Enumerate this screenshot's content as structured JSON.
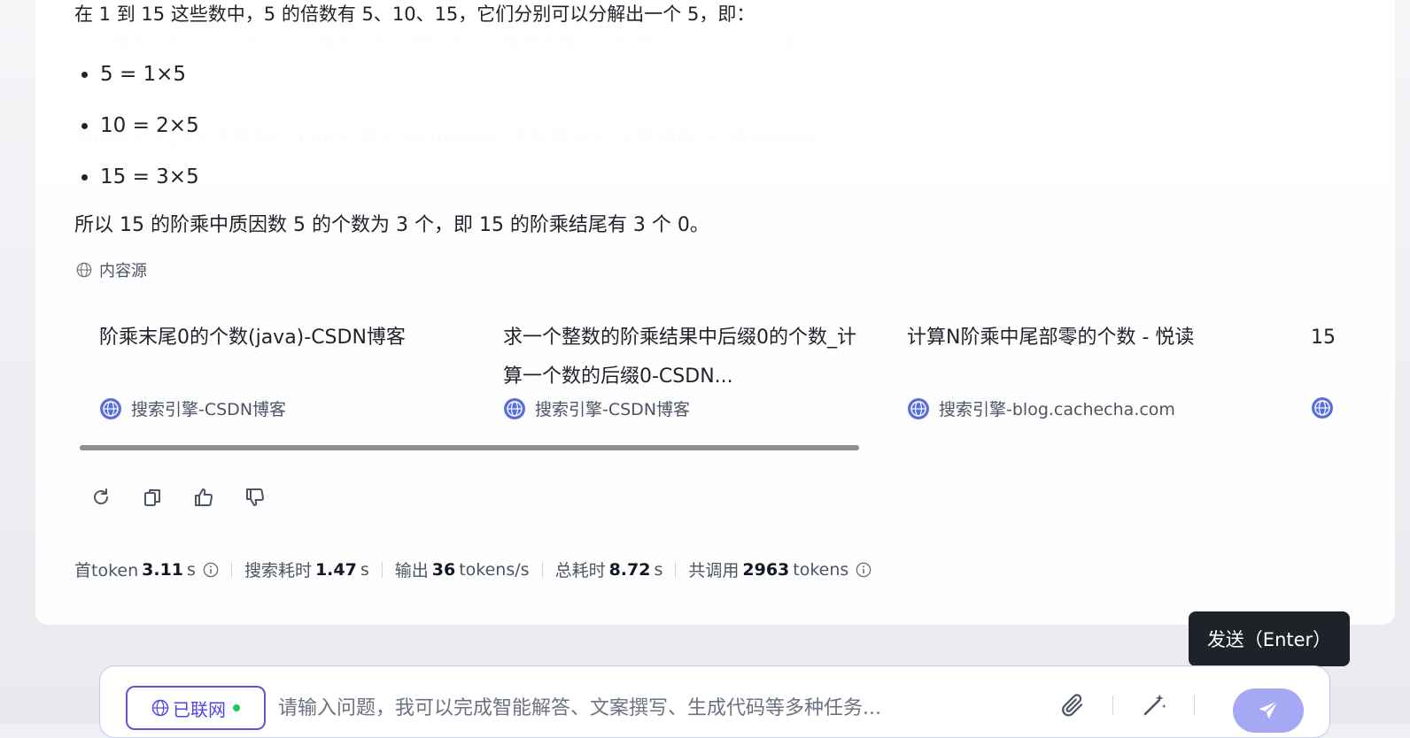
{
  "answer": {
    "intro": "在 1 到 15 这些数中，5 的倍数有 5、10、15，它们分别可以分解出一个 5，即：",
    "bullets": [
      "5 = 1×5",
      "10 = 2×5",
      "15 = 3×5"
    ],
    "conclusion": "所以 15 的阶乘中质因数 5 的个数为 3 个，即 15 的阶乘结尾有 3 个 0。"
  },
  "sources": {
    "heading": "内容源",
    "items": [
      {
        "title": "阶乘末尾0的个数(java)-CSDN博客",
        "source": "搜索引擎-CSDN博客"
      },
      {
        "title": "求一个整数的阶乘结果中后缀0的个数_计算一个数的后缀0-CSDN...",
        "source": "搜索引擎-CSDN博客"
      },
      {
        "title": "计算N阶乘中尾部零的个数 - 悦读",
        "source": "搜索引擎-blog.cachecha.com"
      },
      {
        "title": "15",
        "source": ""
      }
    ]
  },
  "actions": {
    "icons": [
      "refresh-icon",
      "copy-icon",
      "thumbs-up-icon",
      "thumbs-down-icon"
    ]
  },
  "stats": {
    "first_token_label": "首token",
    "first_token_value": "3.11",
    "first_token_unit": "s",
    "search_label": "搜索耗时",
    "search_value": "1.47",
    "search_unit": "s",
    "output_label": "输出",
    "output_value": "36",
    "output_unit": "tokens/s",
    "total_label": "总耗时",
    "total_value": "8.72",
    "total_unit": "s",
    "calls_label": "共调用",
    "calls_value": "2963",
    "calls_unit": "tokens"
  },
  "composer": {
    "network_label": "已联网",
    "placeholder": "请输入问题，我可以完成智能解答、文案撰写、生成代码等多种任务...",
    "send_tooltip": "发送（Enter）"
  },
  "colors": {
    "accent": "#5b57d1",
    "send_button": "#a5a8f2",
    "online_dot": "#22c55e",
    "source_globe": "#5b6ee1"
  }
}
